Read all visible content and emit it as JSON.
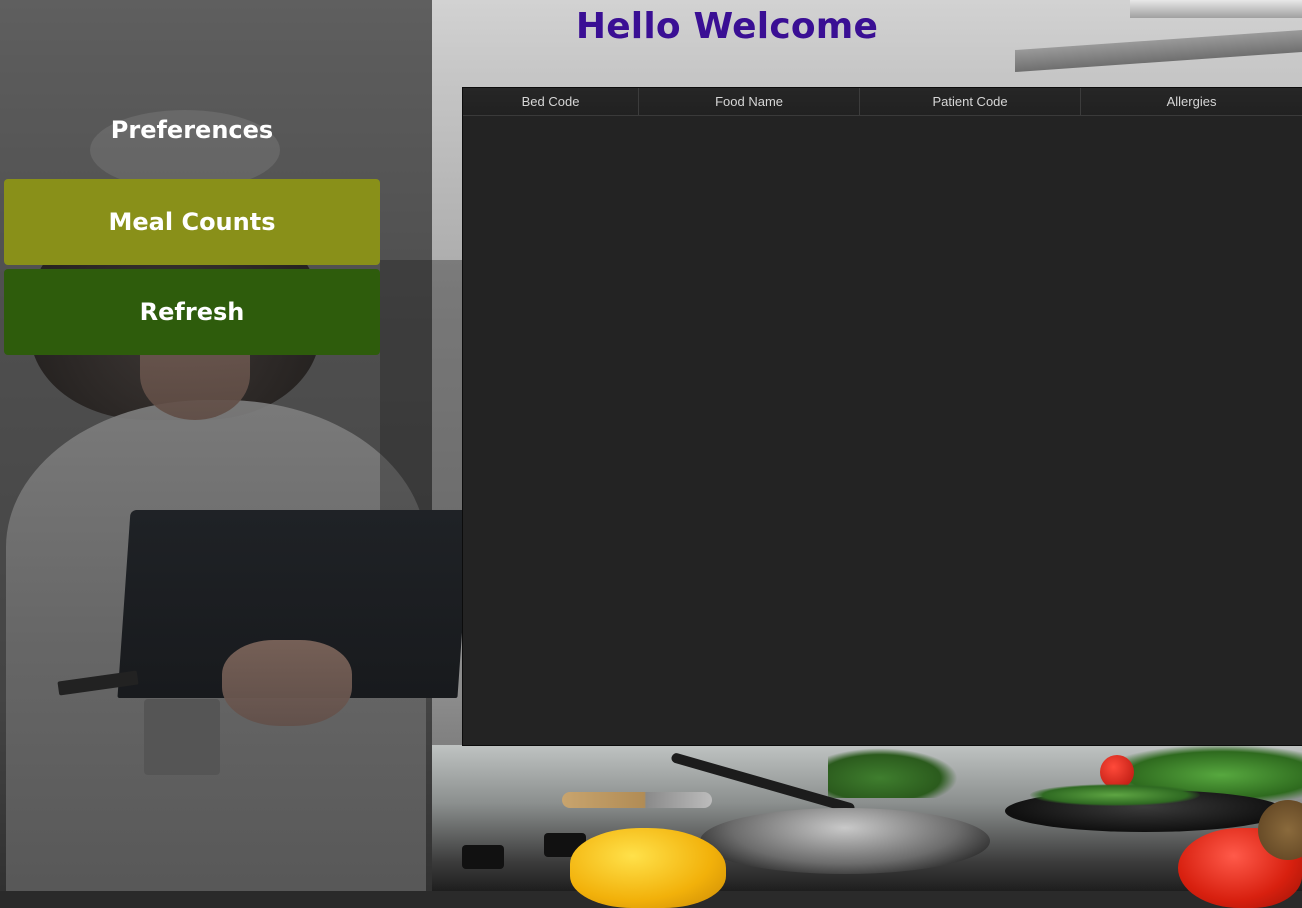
{
  "header": {
    "title": "Hello Welcome"
  },
  "sidebar": {
    "section_label": "Preferences",
    "buttons": [
      {
        "label": "Meal Counts",
        "color": "#899019"
      },
      {
        "label": "Refresh",
        "color": "#2e5c0c"
      }
    ]
  },
  "table": {
    "columns": [
      "Bed Code",
      "Food Name",
      "Patient Code",
      "Allergies"
    ],
    "rows": []
  },
  "colors": {
    "title": "#3a0f94",
    "table_background": "#232323",
    "extra_button": "#555555"
  }
}
